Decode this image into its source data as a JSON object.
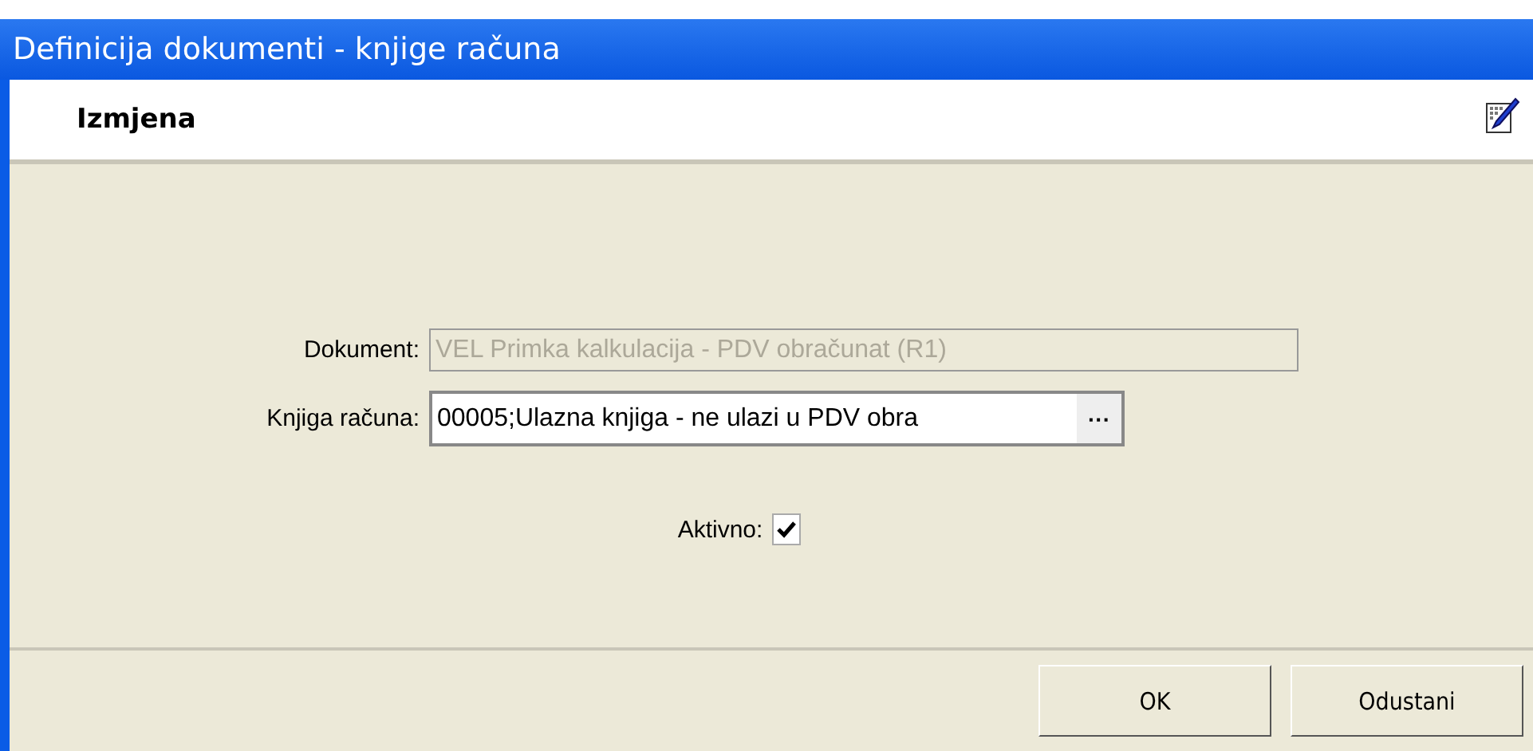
{
  "window": {
    "title": "Definicija dokumenti - knjige računa"
  },
  "header": {
    "title": "Izmjena"
  },
  "fields": [
    {
      "label": "Dokument:",
      "value": "VEL Primka kalkulacija - PDV obračunat (R1)",
      "disabled": true
    },
    {
      "label": "Knjiga računa:",
      "value": "00005;Ulazna knjiga - ne ulazi u PDV obra",
      "disabled": false,
      "browse": "···"
    }
  ],
  "checkbox": {
    "label": "Aktivno:",
    "checked": true
  },
  "buttons": [
    "OK",
    "Odustani"
  ]
}
